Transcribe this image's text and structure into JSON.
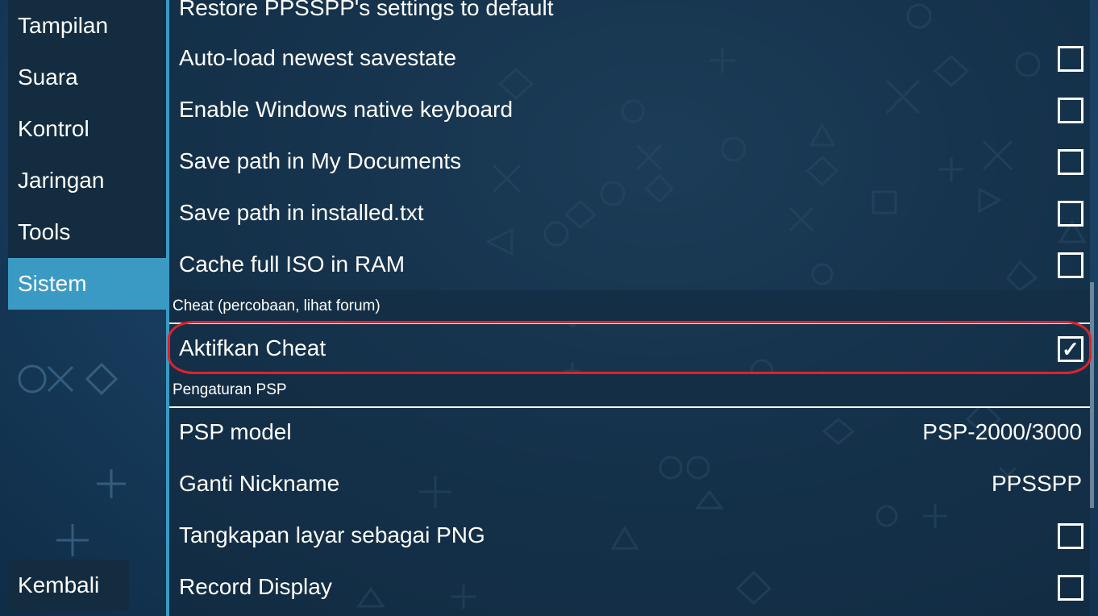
{
  "sidebar": {
    "items": [
      {
        "label": "Tampilan"
      },
      {
        "label": "Suara"
      },
      {
        "label": "Kontrol"
      },
      {
        "label": "Jaringan"
      },
      {
        "label": "Tools"
      },
      {
        "label": "Sistem",
        "active": true
      }
    ],
    "back_label": "Kembali"
  },
  "settings": {
    "partial_top_row": "Restore PPSSPP's settings to default",
    "rows_a": [
      {
        "label": "Auto-load newest savestate",
        "checked": false
      },
      {
        "label": "Enable Windows native keyboard",
        "checked": false
      },
      {
        "label": "Save path in My Documents",
        "checked": false
      },
      {
        "label": "Save path in installed.txt",
        "checked": false
      },
      {
        "label": "Cache full ISO in RAM",
        "checked": false
      }
    ],
    "cheat_header": "Cheat (percobaan, lihat forum)",
    "cheat_row": {
      "label": "Aktifkan Cheat",
      "checked": true,
      "check_glyph": "✓"
    },
    "psp_header": "Pengaturan PSP",
    "psp_model": {
      "label": "PSP model",
      "value": "PSP-2000/3000"
    },
    "nickname": {
      "label": "Ganti Nickname",
      "value": "PPSSPP"
    },
    "rows_b": [
      {
        "label": "Tangkapan layar sebagai PNG",
        "checked": false
      },
      {
        "label": "Record Display",
        "checked": false
      }
    ]
  },
  "colors": {
    "accent": "#3b9ac4",
    "highlight": "#e3202a",
    "panel": "#132c40"
  }
}
